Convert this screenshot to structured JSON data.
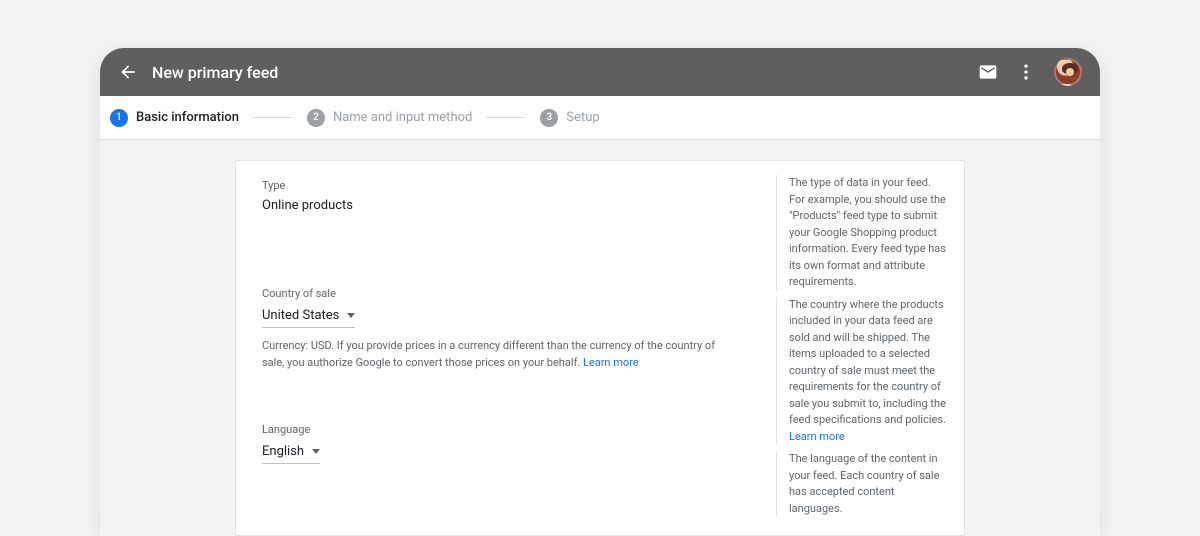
{
  "topbar": {
    "title": "New primary feed"
  },
  "stepper": {
    "steps": [
      {
        "num": "1",
        "label": "Basic information"
      },
      {
        "num": "2",
        "label": "Name and input method"
      },
      {
        "num": "3",
        "label": "Setup"
      }
    ]
  },
  "form": {
    "type": {
      "label": "Type",
      "value": "Online products",
      "help": "The type of data in your feed. For example, you should use the \"Products\" feed type to submit your Google Shopping product information. Every feed type has its own format and attribute requirements."
    },
    "country": {
      "label": "Country of sale",
      "value": "United States",
      "helper_prefix": "Currency: USD. If you provide prices in a currency different than the currency of the country of sale, you authorize Google to convert those prices on your behalf. ",
      "help": "The country where the products included in your data feed are sold and will be shipped. The items uploaded to a selected country of sale must meet the requirements for the country of sale you submit to, including the feed specifications and policies.",
      "learn_more": "Learn more"
    },
    "language": {
      "label": "Language",
      "value": "English",
      "help": "The language of the content in your feed. Each country of sale has accepted content languages."
    }
  }
}
